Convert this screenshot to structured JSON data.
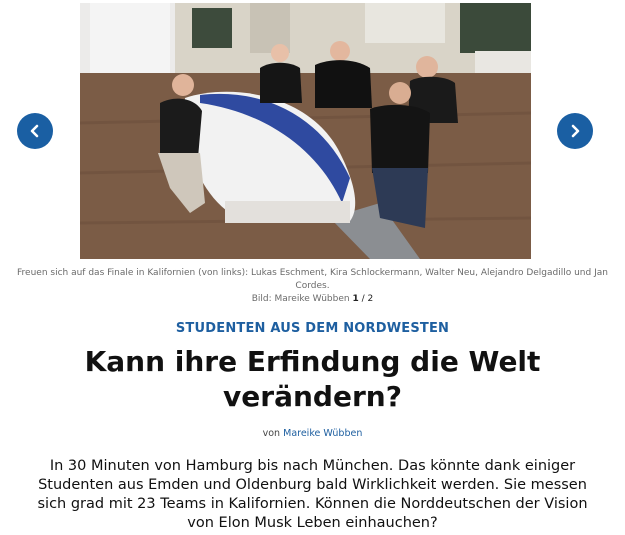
{
  "gallery": {
    "prev_icon": "chevron-left-icon",
    "next_icon": "chevron-right-icon",
    "accent_color": "#1a5fa3",
    "caption": "Freuen sich auf das Finale in Kalifornien (von links): Lukas Eschment, Kira Schlockermann, Walter Neu, Alejandro Delgadillo und Jan Cordes.",
    "credit": "Bild: Mareike Wübben",
    "current": "1",
    "separator": "/",
    "total": "2"
  },
  "article": {
    "kicker": "STUDENTEN AUS DEM NORDWESTEN",
    "headline": "Kann ihre Erfindung die Welt verändern?",
    "byline_prefix": "von",
    "author": "Mareike Wübben",
    "teaser": "In 30 Minuten von Hamburg bis nach München. Das könnte dank einiger Studenten aus Emden und Oldenburg bald Wirklichkeit werden. Sie messen sich grad mit 23 Teams in Kalifornien. Können die Norddeutschen der Vision von Elon Musk Leben einhauchen?"
  }
}
